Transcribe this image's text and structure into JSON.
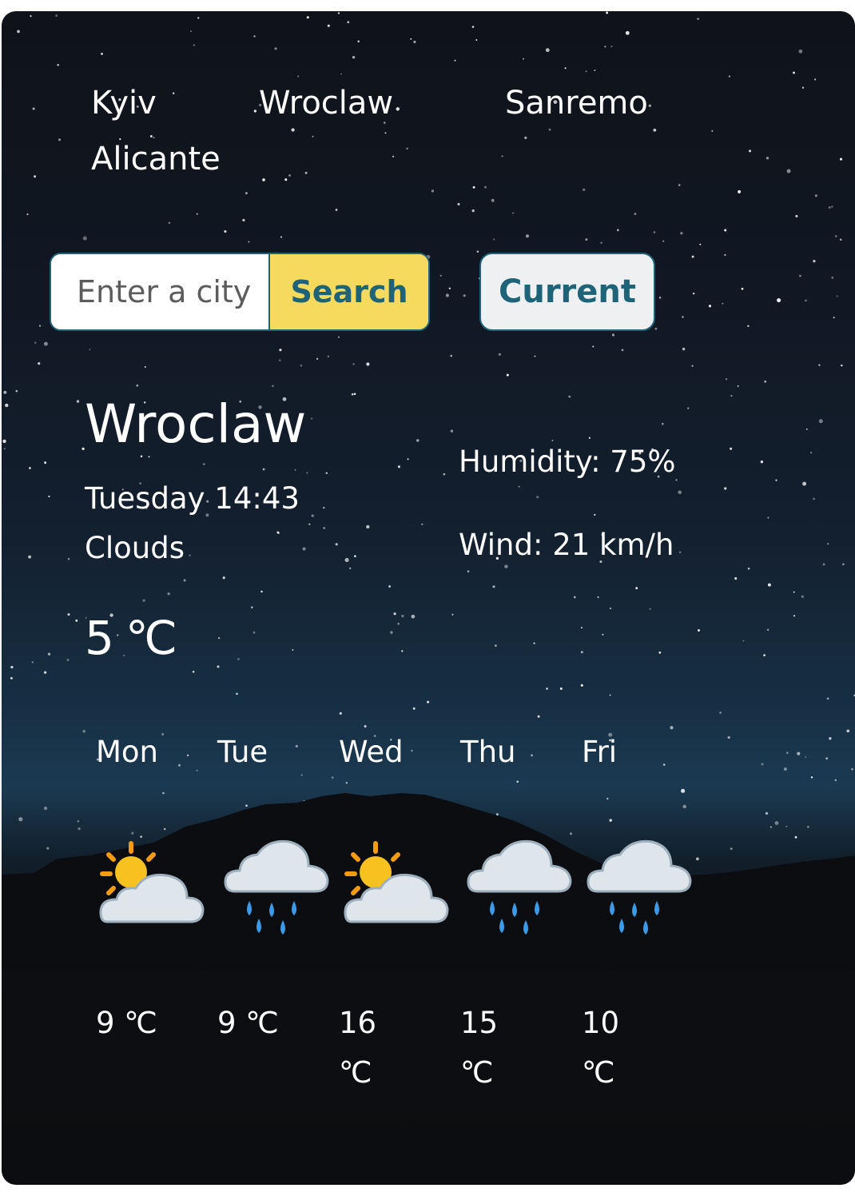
{
  "nav": {
    "cities": [
      "Kyiv",
      "Wroclaw",
      "Sanremo",
      "Alicante"
    ]
  },
  "search": {
    "placeholder": "Enter a city",
    "button_label": "Search",
    "current_label": "Current"
  },
  "weather": {
    "city": "Wroclaw",
    "date": "Tuesday 14:43",
    "description": "Clouds",
    "temperature": "5",
    "unit": "℃",
    "humidity": "Humidity: 75%",
    "wind": "Wind: 21 km/h"
  },
  "forecast": [
    {
      "day": "Mon",
      "icon": "sun-behind-cloud-icon",
      "temp": "9 ℃"
    },
    {
      "day": "Tue",
      "icon": "cloud-with-rain-icon",
      "temp": "9 ℃"
    },
    {
      "day": "Wed",
      "icon": "sun-behind-cloud-icon",
      "temp": "16 ℃"
    },
    {
      "day": "Thu",
      "icon": "cloud-with-rain-icon",
      "temp": "15 ℃"
    },
    {
      "day": "Fri",
      "icon": "cloud-with-rain-icon",
      "temp": "10 ℃"
    }
  ],
  "colors": {
    "accent": "#1f6378",
    "search_button": "#f5da5e",
    "current_button": "#eef0f1"
  }
}
